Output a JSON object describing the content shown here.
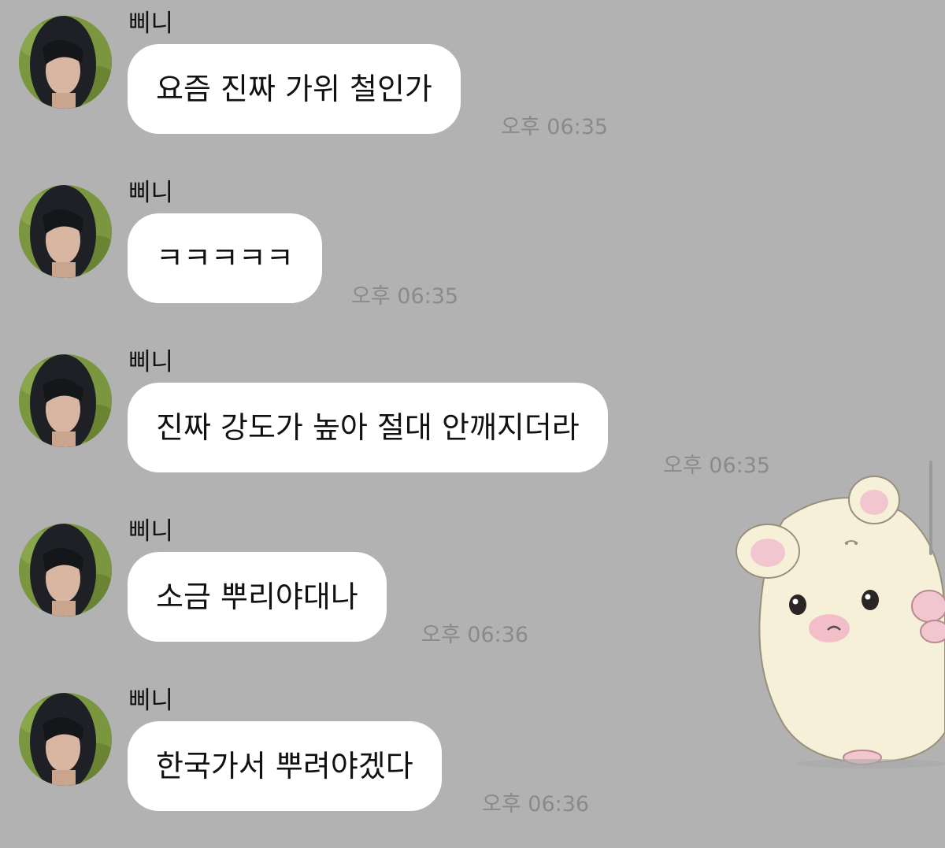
{
  "messages": [
    {
      "sender": "삐니",
      "text": "요즘 진짜 가위 철인가",
      "time": "오후 06:35"
    },
    {
      "sender": "삐니",
      "text": "ㅋㅋㅋㅋㅋ",
      "time": "오후 06:35"
    },
    {
      "sender": "삐니",
      "text": "진짜 강도가 높아 절대 안깨지더라",
      "time": "오후 06:35"
    },
    {
      "sender": "삐니",
      "text": "소금 뿌리야대나",
      "time": "오후 06:36"
    },
    {
      "sender": "삐니",
      "text": "한국가서 뿌려야겠다",
      "time": "오후 06:36"
    }
  ],
  "colors": {
    "background": "#b2b2b2",
    "bubble": "#ffffff",
    "timestamp": "#8a8a8a"
  },
  "sticker": {
    "icon": "hamster-sticker-icon"
  },
  "avatar": {
    "icon": "profile-photo-icon"
  }
}
